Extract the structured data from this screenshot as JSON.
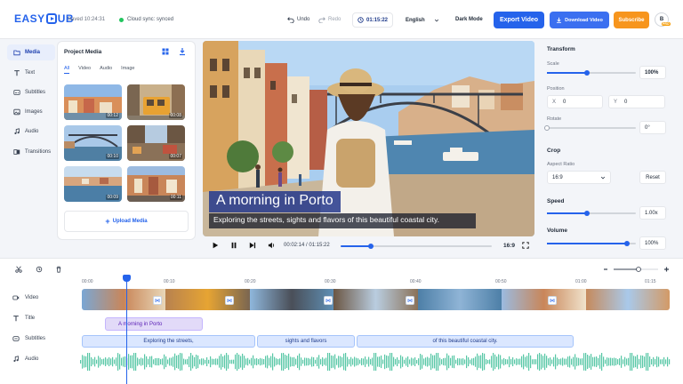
{
  "app": {
    "brand": "EASYSUB",
    "saved": "Saved 10:24:31",
    "sync": "Cloud sync: synced"
  },
  "topbar": {
    "undo": "Undo",
    "redo": "Redo",
    "time": "01:15:22",
    "language": "English",
    "dark_mode": "Dark Mode",
    "export": "Export Video",
    "download": "Download Video",
    "subscribe": "Subscribe",
    "avatar_letter": "B",
    "avatar_badge": "PRO"
  },
  "nav": [
    {
      "label": "Media",
      "icon": "folder-icon",
      "active": true
    },
    {
      "label": "Text",
      "icon": "text-icon"
    },
    {
      "label": "Subtitles",
      "icon": "subtitles-icon"
    },
    {
      "label": "Images",
      "icon": "image-icon"
    },
    {
      "label": "Audio",
      "icon": "music-icon"
    },
    {
      "label": "Transitions",
      "icon": "transitions-icon"
    }
  ],
  "media": {
    "title": "Project Media",
    "tabs": [
      "All",
      "Video",
      "Audio",
      "Image"
    ],
    "thumbs": [
      {
        "duration": "00:12"
      },
      {
        "duration": "00:08"
      },
      {
        "duration": "00:10"
      },
      {
        "duration": "00:07"
      },
      {
        "duration": "00:09"
      },
      {
        "duration": "00:11"
      }
    ],
    "upload": "Upload Media"
  },
  "preview": {
    "caption_title": "A morning in Porto",
    "caption_sub": "Exploring the streets, sights and flavors of this beautiful coastal city.",
    "current": "00:02:14",
    "total": "01:15:22",
    "separator": "/",
    "aspect": "16:9",
    "progress": 0.2
  },
  "transform": {
    "heading": "Transform",
    "scale_label": "Scale",
    "scale_value": "100%",
    "scale_level": 0.45,
    "position_label": "Position",
    "x_label": "X",
    "x_value": "0",
    "y_label": "Y",
    "y_value": "0",
    "rotate_label": "Rotate",
    "rotate_value": "0°",
    "rotate_level": 0.0
  },
  "crop": {
    "heading": "Crop",
    "aspect_label": "Aspect Ratio",
    "aspect_value": "16:9",
    "reset": "Reset"
  },
  "speed": {
    "heading": "Speed",
    "value": "1.00x",
    "level": 0.45
  },
  "volume": {
    "heading": "Volume",
    "value": "100%",
    "level": 0.9
  },
  "timeline": {
    "ticks": [
      "00:00",
      "00:10",
      "00:20",
      "00:30",
      "00:40",
      "00:50",
      "01:00",
      "01:15"
    ],
    "tracks": [
      {
        "label": "Video",
        "icon": "video-icon"
      },
      {
        "label": "Title",
        "icon": "title-icon"
      },
      {
        "label": "Subtitles",
        "icon": "subtitles-icon"
      },
      {
        "label": "Audio",
        "icon": "audio-icon"
      }
    ],
    "title_clip": "A morning in Porto",
    "subtitle_clips": [
      "Exploring the streets,",
      "sights and flavors",
      "of this beautiful coastal city."
    ]
  }
}
